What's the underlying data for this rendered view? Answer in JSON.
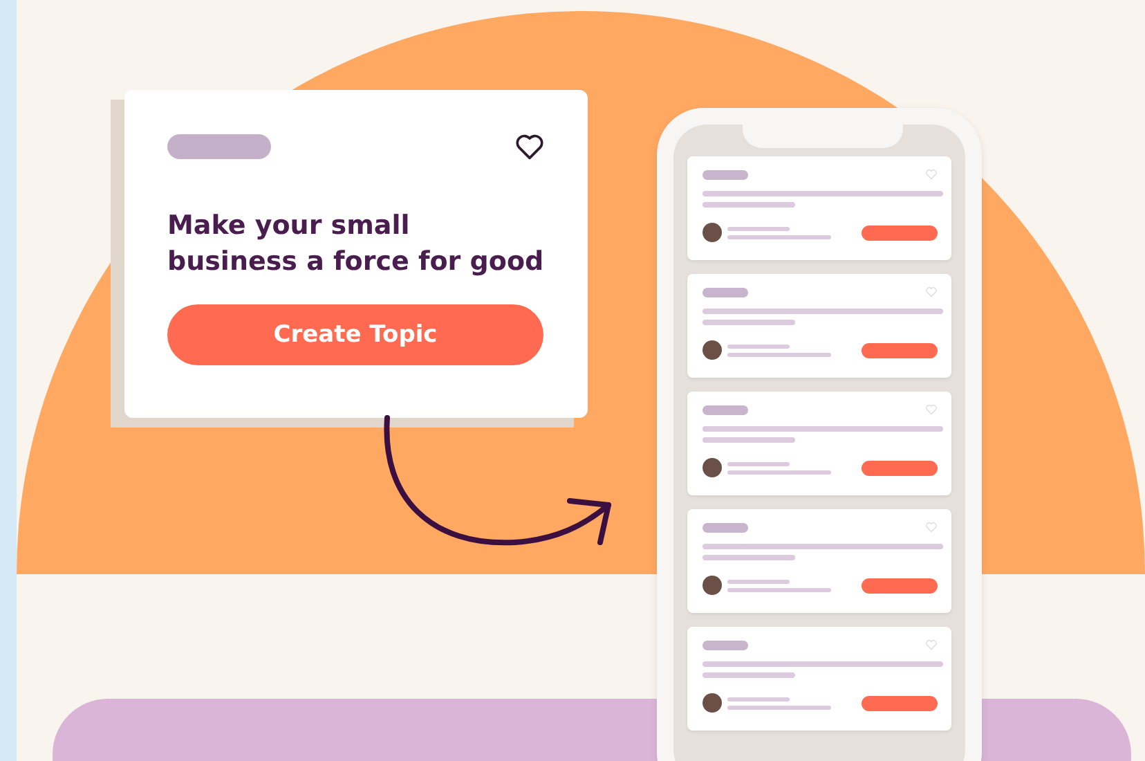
{
  "card": {
    "title": "Make your small business a force for good",
    "button": "Create Topic"
  },
  "phone": {
    "cards": [
      {
        "kind": "topic"
      },
      {
        "kind": "topic"
      },
      {
        "kind": "topic"
      },
      {
        "kind": "topic"
      },
      {
        "kind": "topic"
      }
    ]
  }
}
